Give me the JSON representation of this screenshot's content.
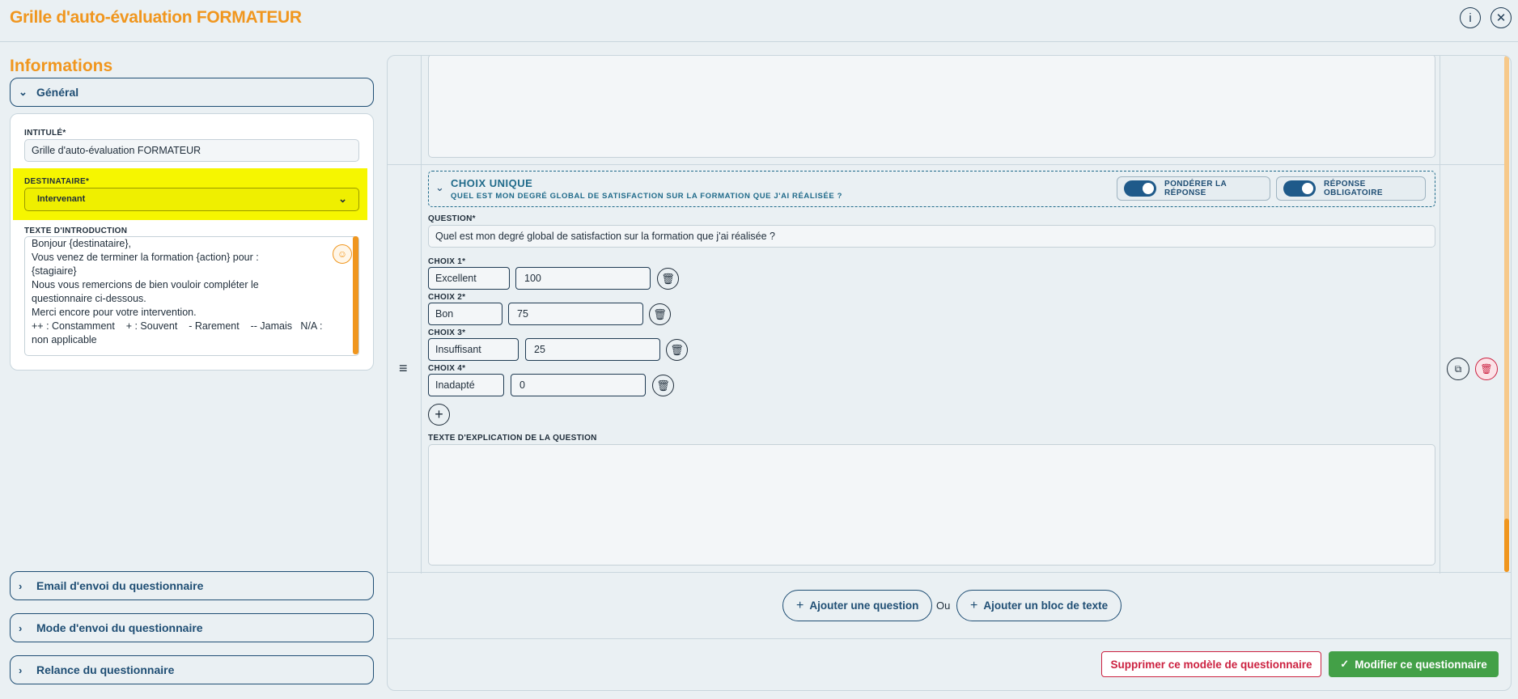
{
  "header": {
    "title": "Grille d'auto-évaluation FORMATEUR",
    "info_icon": "info-icon",
    "close_icon": "close-icon"
  },
  "left": {
    "section_title": "Informations",
    "general": {
      "label": "Général",
      "intitule_label": "INTITULÉ*",
      "intitule_value": "Grille d'auto-évaluation FORMATEUR",
      "destinataire_label": "DESTINATAIRE*",
      "destinataire_value": "Intervenant",
      "intro_label": "TEXTE D'INTRODUCTION",
      "intro_lines": [
        "Bonjour {destinataire},",
        "Vous venez de terminer la formation {action} pour :",
        "{stagiaire}",
        "Nous vous remercions de bien vouloir compléter le",
        "questionnaire ci-dessous.",
        "Merci encore pour votre intervention.",
        "",
        "++ : Constamment    + : Souvent    - Rarement    -- Jamais   N/A :",
        "non applicable"
      ]
    },
    "accordions": [
      "Email d'envoi du questionnaire",
      "Mode d'envoi du questionnaire",
      "Relance du questionnaire"
    ]
  },
  "question": {
    "type_label": "CHOIX UNIQUE",
    "subtitle": "QUEL EST MON DEGRÉ GLOBAL DE SATISFACTION SUR LA FORMATION QUE J'AI RÉALISÉE ?",
    "toggle_weight": "PONDÉRER LA RÉPONSE",
    "toggle_required": "RÉPONSE OBLIGATOIRE",
    "question_label": "QUESTION*",
    "question_value": "Quel est mon degré global de satisfaction sur la formation que j'ai réalisée ?",
    "choices": [
      {
        "label": "CHOIX 1*",
        "name": "Excellent",
        "value": "100"
      },
      {
        "label": "CHOIX 2*",
        "name": "Bon",
        "value": "75"
      },
      {
        "label": "CHOIX 3*",
        "name": "Insuffisant",
        "value": "25"
      },
      {
        "label": "CHOIX 4*",
        "name": "Inadapté",
        "value": "0"
      }
    ],
    "explanation_label": "TEXTE D'EXPLICATION DE LA QUESTION"
  },
  "actions": {
    "add_question": "Ajouter une question",
    "or": "Ou",
    "add_text_block": "Ajouter un bloc de texte",
    "delete_model": "Supprimer ce modèle de questionnaire",
    "save": "Modifier ce questionnaire"
  },
  "colors": {
    "accent_orange": "#f0961e",
    "primary_blue": "#1f4e74",
    "danger_red": "#cc2140",
    "success_green": "#43a047",
    "highlight_yellow": "#f6f600"
  }
}
